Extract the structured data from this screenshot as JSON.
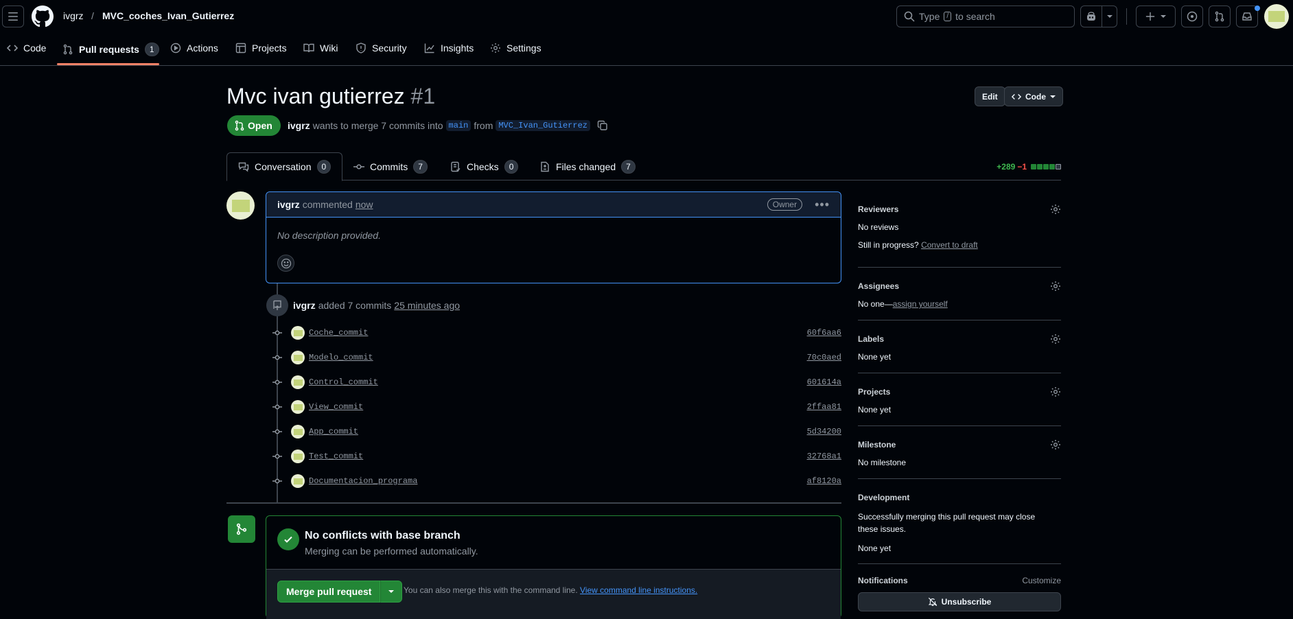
{
  "header": {
    "owner": "ivgrz",
    "separator": "/",
    "repo": "MVC_coches_Ivan_Gutierrez",
    "search_prefix": "Type",
    "search_key": "/",
    "search_suffix": "to search"
  },
  "nav": {
    "code": "Code",
    "pull_requests": "Pull requests",
    "pull_requests_count": "1",
    "actions": "Actions",
    "projects": "Projects",
    "wiki": "Wiki",
    "security": "Security",
    "insights": "Insights",
    "settings": "Settings"
  },
  "pr": {
    "title": "Mvc ivan gutierrez",
    "number": "#1",
    "edit_label": "Edit",
    "code_label": "Code",
    "state": "Open",
    "author": "ivgrz",
    "merge_text": "wants to merge 7 commits into",
    "base_branch": "main",
    "from_text": "from",
    "head_branch": "MVC_Ivan_Gutierrez"
  },
  "tabs": [
    {
      "label": "Conversation",
      "count": "0"
    },
    {
      "label": "Commits",
      "count": "7"
    },
    {
      "label": "Checks",
      "count": "0"
    },
    {
      "label": "Files changed",
      "count": "7"
    }
  ],
  "diffstat": {
    "additions": "+289",
    "deletions": "−1"
  },
  "comment": {
    "author": "ivgrz",
    "action": "commented",
    "time": "now",
    "badge": "Owner",
    "body": "No description provided."
  },
  "event": {
    "author": "ivgrz",
    "action": "added 7 commits",
    "time": "25 minutes ago"
  },
  "commits": [
    {
      "message": "Coche_commit",
      "sha": "60f6aa6"
    },
    {
      "message": "Modelo_commit",
      "sha": "70c0aed"
    },
    {
      "message": "Control_commit",
      "sha": "601614a"
    },
    {
      "message": "View_commit",
      "sha": "2ffaa81"
    },
    {
      "message": "App_commit",
      "sha": "5d34200"
    },
    {
      "message": "Test_commit",
      "sha": "32768a1"
    },
    {
      "message": "Documentacion_programa",
      "sha": "af8120a"
    }
  ],
  "merge": {
    "title": "No conflicts with base branch",
    "subtitle": "Merging can be performed automatically.",
    "button": "Merge pull request",
    "hint": "You can also merge this with the command line.",
    "hint_link": "View command line instructions."
  },
  "sidebar": {
    "reviewers_h": "Reviewers",
    "reviewers_v": "No reviews",
    "in_progress": "Still in progress?",
    "convert_draft": "Convert to draft",
    "assignees_h": "Assignees",
    "assignees_v": "No one—",
    "assign_yourself": "assign yourself",
    "labels_h": "Labels",
    "labels_v": "None yet",
    "projects_h": "Projects",
    "projects_v": "None yet",
    "milestone_h": "Milestone",
    "milestone_v": "No milestone",
    "development_h": "Development",
    "development_desc": "Successfully merging this pull request may close these issues.",
    "development_v": "None yet",
    "notifications_h": "Notifications",
    "customize": "Customize",
    "unsubscribe": "Unsubscribe"
  }
}
